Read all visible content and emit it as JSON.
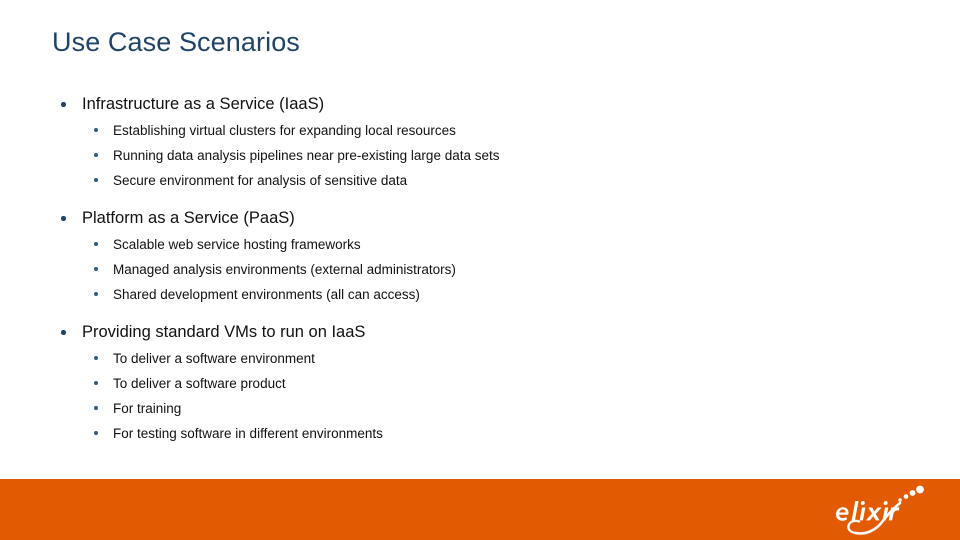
{
  "slide": {
    "title": "Use Case Scenarios",
    "title_color": "#1F4369",
    "background_color": "#FFFFFF",
    "text_color": "#111111",
    "bullet_color": "#1F4369",
    "sub_bullet_color": "#2B5D86"
  },
  "content": {
    "groups": [
      {
        "heading": "Infrastructure as a Service (IaaS)",
        "items": [
          "Establishing virtual clusters for expanding local resources",
          "Running data analysis pipelines near pre-existing large data sets",
          "Secure environment for analysis of sensitive data"
        ]
      },
      {
        "heading": "Platform as a Service (PaaS)",
        "items": [
          "Scalable web service hosting frameworks",
          "Managed analysis environments (external administrators)",
          "Shared development environments (all can access)"
        ]
      },
      {
        "heading": "Providing standard VMs to run on IaaS",
        "items": [
          "To deliver a software environment",
          "To deliver a software product",
          "For training",
          "For testing software in different environments"
        ]
      }
    ]
  },
  "footer": {
    "bar_color": "#E25B02",
    "logo": {
      "name": "elixir-logo",
      "wordmark": "elixir",
      "wordmark_color": "#FFFFFF"
    }
  }
}
